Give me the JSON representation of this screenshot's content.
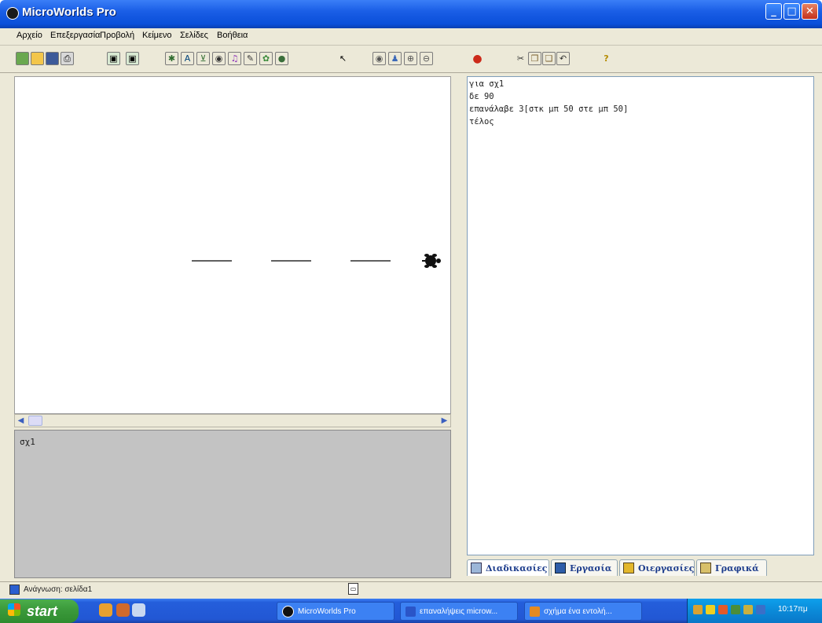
{
  "window": {
    "title": "MicroWorlds Pro"
  },
  "menu": [
    "Αρχείο",
    "Επεξεργασία",
    "Προβολή",
    "Κείμενο",
    "Σελίδες",
    "Βοήθεια"
  ],
  "command_center": {
    "text": "σχ1"
  },
  "procedures": {
    "lines": [
      "για σχ1",
      "δε 90",
      "επανάλαβε 3[στκ μπ 50 στε μπ 50]",
      "τέλος"
    ]
  },
  "tabs": [
    "Διαδικασίες",
    "Εργασία",
    "Οιεργασίες",
    "Γραφικά"
  ],
  "status": {
    "text": "Ανάγνωση: σελίδα1"
  },
  "taskbar": {
    "start_label": "start",
    "buttons": [
      "MicroWorlds Pro",
      "επαναλήψεις microw...",
      "σχήμα ένα εντολή..."
    ],
    "clock": "10:17πμ"
  },
  "colors": {
    "title_bar": "#0a4fd9",
    "taskbar": "#245edb",
    "start_button": "#3c9b3c",
    "tray": "#0b8ad8",
    "command_center_bg": "#c3c3c3"
  }
}
